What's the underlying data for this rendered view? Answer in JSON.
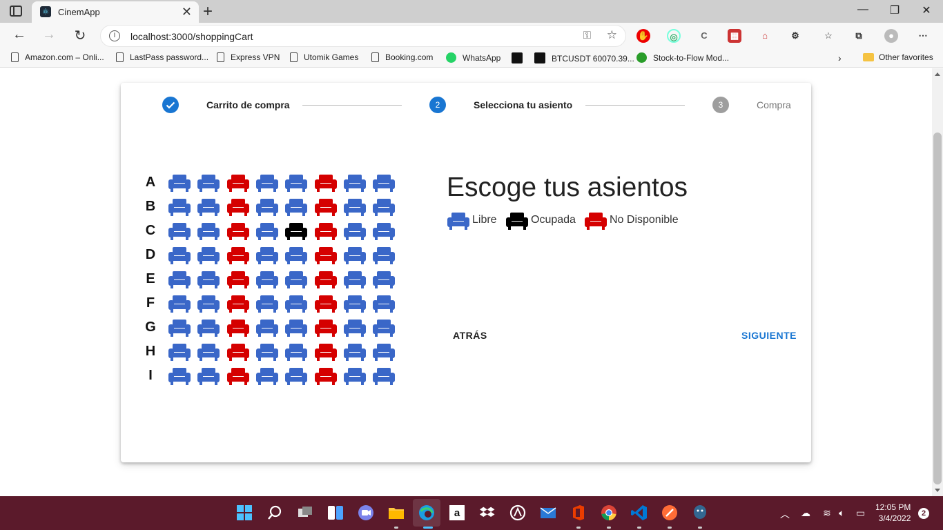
{
  "browser": {
    "tab_title": "CinemApp",
    "address": "localhost:3000/shoppingCart",
    "bookmarks": [
      "Amazon.com – Onli...",
      "LastPass password...",
      "Express VPN",
      "Utomik Games",
      "Booking.com",
      "WhatsApp",
      "",
      "BTCUSDT 60070.39...",
      "Stock-to-Flow Mod..."
    ],
    "other_favorites": "Other favorites"
  },
  "stepper": {
    "step1": {
      "label": "Carrito de compra",
      "state": "completed"
    },
    "step2": {
      "number": "2",
      "label": "Selecciona tu asiento",
      "state": "active"
    },
    "step3": {
      "number": "3",
      "label": "Compra",
      "state": "inactive"
    }
  },
  "seating": {
    "rows": [
      "A",
      "B",
      "C",
      "D",
      "E",
      "F",
      "G",
      "H",
      "I"
    ],
    "columns": 8,
    "seat_map": [
      [
        "free",
        "free",
        "unavailable",
        "free",
        "free",
        "unavailable",
        "free",
        "free"
      ],
      [
        "free",
        "free",
        "unavailable",
        "free",
        "free",
        "unavailable",
        "free",
        "free"
      ],
      [
        "free",
        "free",
        "unavailable",
        "free",
        "occupied",
        "unavailable",
        "free",
        "free"
      ],
      [
        "free",
        "free",
        "unavailable",
        "free",
        "free",
        "unavailable",
        "free",
        "free"
      ],
      [
        "free",
        "free",
        "unavailable",
        "free",
        "free",
        "unavailable",
        "free",
        "free"
      ],
      [
        "free",
        "free",
        "unavailable",
        "free",
        "free",
        "unavailable",
        "free",
        "free"
      ],
      [
        "free",
        "free",
        "unavailable",
        "free",
        "free",
        "unavailable",
        "free",
        "free"
      ],
      [
        "free",
        "free",
        "unavailable",
        "free",
        "free",
        "unavailable",
        "free",
        "free"
      ],
      [
        "free",
        "free",
        "unavailable",
        "free",
        "free",
        "unavailable",
        "free",
        "free"
      ]
    ]
  },
  "panel": {
    "heading": "Escoge tus asientos",
    "legend": {
      "free": "Libre",
      "occupied": "Ocupada",
      "unavailable": "No Disponible"
    },
    "back_label": "ATRÁS",
    "next_label": "SIGUIENTE"
  },
  "colors": {
    "free": "#3a67c8",
    "occupied": "#000000",
    "unavailable": "#d50000",
    "primary": "#1976d2",
    "inactive": "#9e9e9e"
  },
  "taskbar": {
    "time": "12:05 PM",
    "date": "3/4/2022",
    "notifications": "2"
  }
}
